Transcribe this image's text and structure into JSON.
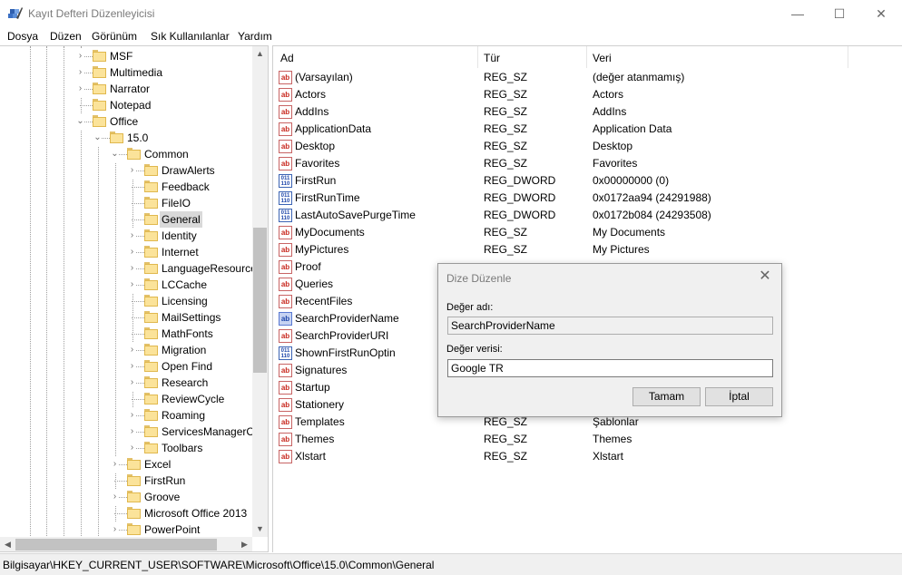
{
  "window": {
    "title": "Kayıt Defteri Düzenleyicisi",
    "minimize_glyph": "—",
    "maximize_glyph": "☐",
    "close_glyph": "✕"
  },
  "menu": [
    "Dosya",
    "Düzen",
    "Görünüm",
    "Sık Kullanılanlar",
    "Yardım"
  ],
  "tree": [
    {
      "label": "MSF",
      "indent": 1,
      "expander": "collapsed"
    },
    {
      "label": "Multimedia",
      "indent": 1,
      "expander": "collapsed"
    },
    {
      "label": "Narrator",
      "indent": 1,
      "expander": "collapsed"
    },
    {
      "label": "Notepad",
      "indent": 1,
      "expander": "none"
    },
    {
      "label": "Office",
      "indent": 1,
      "expander": "expanded"
    },
    {
      "label": "15.0",
      "indent": 2,
      "expander": "expanded"
    },
    {
      "label": "Common",
      "indent": 3,
      "expander": "expanded"
    },
    {
      "label": "DrawAlerts",
      "indent": 4,
      "expander": "collapsed"
    },
    {
      "label": "Feedback",
      "indent": 4,
      "expander": "none"
    },
    {
      "label": "FileIO",
      "indent": 4,
      "expander": "none"
    },
    {
      "label": "General",
      "indent": 4,
      "expander": "none",
      "selected": true
    },
    {
      "label": "Identity",
      "indent": 4,
      "expander": "collapsed"
    },
    {
      "label": "Internet",
      "indent": 4,
      "expander": "collapsed"
    },
    {
      "label": "LanguageResources",
      "indent": 4,
      "expander": "collapsed"
    },
    {
      "label": "LCCache",
      "indent": 4,
      "expander": "collapsed"
    },
    {
      "label": "Licensing",
      "indent": 4,
      "expander": "none"
    },
    {
      "label": "MailSettings",
      "indent": 4,
      "expander": "none"
    },
    {
      "label": "MathFonts",
      "indent": 4,
      "expander": "none"
    },
    {
      "label": "Migration",
      "indent": 4,
      "expander": "collapsed"
    },
    {
      "label": "Open Find",
      "indent": 4,
      "expander": "collapsed"
    },
    {
      "label": "Research",
      "indent": 4,
      "expander": "collapsed"
    },
    {
      "label": "ReviewCycle",
      "indent": 4,
      "expander": "none"
    },
    {
      "label": "Roaming",
      "indent": 4,
      "expander": "collapsed"
    },
    {
      "label": "ServicesManagerCache",
      "indent": 4,
      "expander": "collapsed"
    },
    {
      "label": "Toolbars",
      "indent": 4,
      "expander": "collapsed"
    },
    {
      "label": "Excel",
      "indent": 3,
      "expander": "collapsed"
    },
    {
      "label": "FirstRun",
      "indent": 3,
      "expander": "none"
    },
    {
      "label": "Groove",
      "indent": 3,
      "expander": "collapsed"
    },
    {
      "label": "Microsoft Office 2013",
      "indent": 3,
      "expander": "none"
    },
    {
      "label": "PowerPoint",
      "indent": 3,
      "expander": "collapsed"
    }
  ],
  "list": {
    "columns": [
      "Ad",
      "Tür",
      "Veri"
    ],
    "rows": [
      {
        "icon": "sz",
        "name": "(Varsayılan)",
        "type": "REG_SZ",
        "data": "(değer atanmamış)"
      },
      {
        "icon": "sz",
        "name": "Actors",
        "type": "REG_SZ",
        "data": "Actors"
      },
      {
        "icon": "sz",
        "name": "AddIns",
        "type": "REG_SZ",
        "data": "AddIns"
      },
      {
        "icon": "sz",
        "name": "ApplicationData",
        "type": "REG_SZ",
        "data": "Application Data"
      },
      {
        "icon": "sz",
        "name": "Desktop",
        "type": "REG_SZ",
        "data": "Desktop"
      },
      {
        "icon": "sz",
        "name": "Favorites",
        "type": "REG_SZ",
        "data": "Favorites"
      },
      {
        "icon": "dword",
        "name": "FirstRun",
        "type": "REG_DWORD",
        "data": "0x00000000 (0)"
      },
      {
        "icon": "dword",
        "name": "FirstRunTime",
        "type": "REG_DWORD",
        "data": "0x0172aa94 (24291988)"
      },
      {
        "icon": "dword",
        "name": "LastAutoSavePurgeTime",
        "type": "REG_DWORD",
        "data": "0x0172b084 (24293508)"
      },
      {
        "icon": "sz",
        "name": "MyDocuments",
        "type": "REG_SZ",
        "data": "My Documents"
      },
      {
        "icon": "sz",
        "name": "MyPictures",
        "type": "REG_SZ",
        "data": "My Pictures"
      },
      {
        "icon": "sz",
        "name": "Proof",
        "type": "",
        "data": ""
      },
      {
        "icon": "sz",
        "name": "Queries",
        "type": "",
        "data": ""
      },
      {
        "icon": "sz",
        "name": "RecentFiles",
        "type": "",
        "data": ""
      },
      {
        "icon": "sz-selected",
        "name": "SearchProviderName",
        "type": "",
        "data": ""
      },
      {
        "icon": "sz",
        "name": "SearchProviderURI",
        "type": "",
        "data": ""
      },
      {
        "icon": "dword",
        "name": "ShownFirstRunOptin",
        "type": "",
        "data": ""
      },
      {
        "icon": "sz",
        "name": "Signatures",
        "type": "",
        "data": ""
      },
      {
        "icon": "sz",
        "name": "Startup",
        "type": "",
        "data": ""
      },
      {
        "icon": "sz",
        "name": "Stationery",
        "type": "",
        "data": ""
      },
      {
        "icon": "sz",
        "name": "Templates",
        "type": "REG_SZ",
        "data": "Şablonlar"
      },
      {
        "icon": "sz",
        "name": "Themes",
        "type": "REG_SZ",
        "data": "Themes"
      },
      {
        "icon": "sz",
        "name": "Xlstart",
        "type": "REG_SZ",
        "data": "Xlstart"
      }
    ]
  },
  "status": {
    "path": "Bilgisayar\\HKEY_CURRENT_USER\\SOFTWARE\\Microsoft\\Office\\15.0\\Common\\General"
  },
  "dialog": {
    "title": "Dize Düzenle",
    "value_name_label": "Değer adı:",
    "value_name": "SearchProviderName",
    "value_data_label": "Değer verisi:",
    "value_data": "Google TR",
    "ok_label": "Tamam",
    "cancel_label": "İptal",
    "close_glyph": "✕"
  },
  "icons": {
    "string_value": "ab",
    "dword_value": "011\n110",
    "expand_collapsed": "›",
    "expand_expanded": "⌄",
    "scroll_up": "▲",
    "scroll_down": "▼",
    "scroll_left": "◀",
    "scroll_right": "▶"
  },
  "colors": {
    "folder_fill": "#fbe39a",
    "folder_border": "#e0b84e",
    "selection": "#d9d9d9",
    "chrome": "#f0f0f0"
  }
}
